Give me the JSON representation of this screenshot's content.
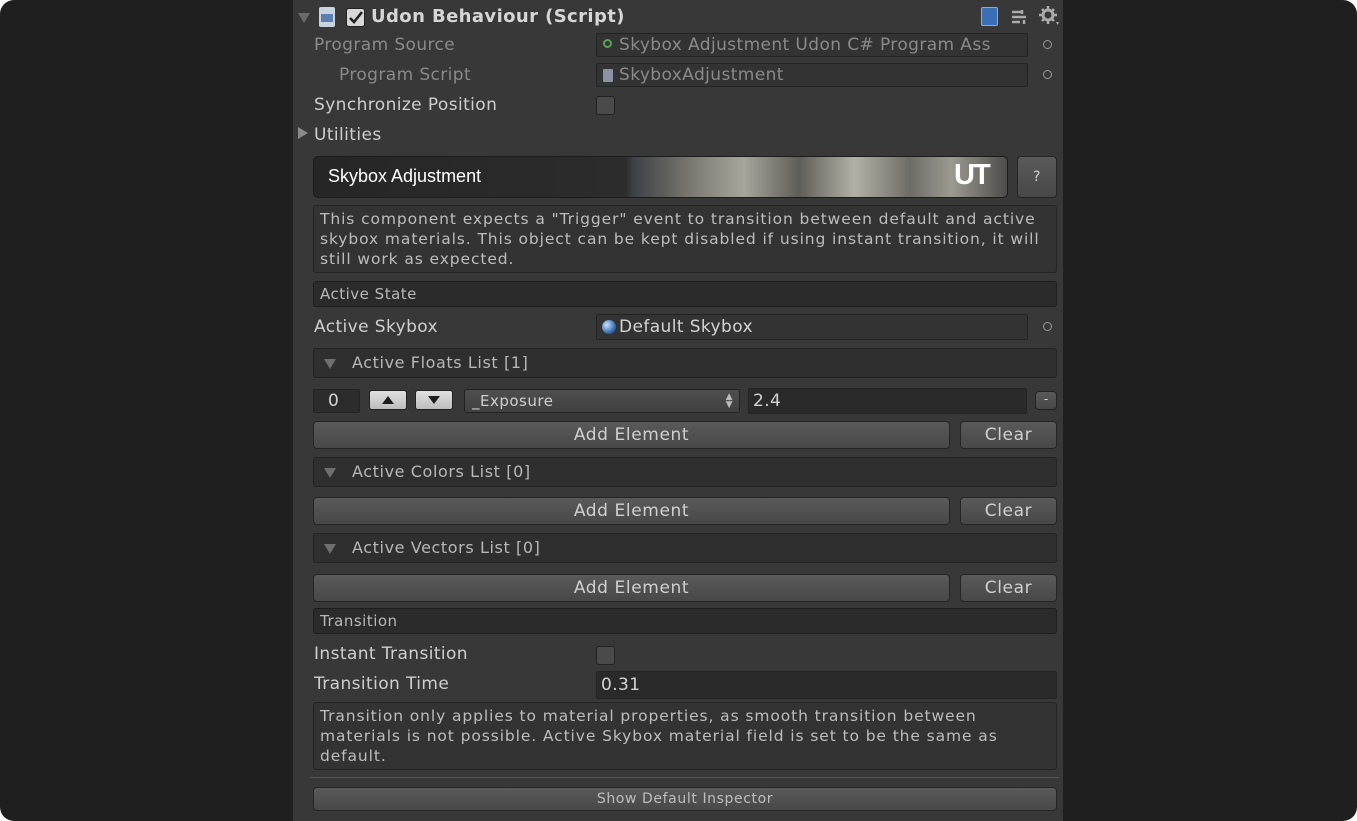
{
  "header": {
    "title": "Udon Behaviour (Script)",
    "enabled": true
  },
  "program_source": {
    "label": "Program Source",
    "value": "Skybox Adjustment Udon C# Program Ass"
  },
  "program_script": {
    "label": "Program Script",
    "value": "SkyboxAdjustment"
  },
  "synchronize_position": {
    "label": "Synchronize Position",
    "checked": false
  },
  "utilities": {
    "label": "Utilities"
  },
  "banner": {
    "title": "Skybox Adjustment",
    "logo_text": "UT",
    "help_label": "?"
  },
  "description": "This component expects a \"Trigger\" event to transition between default and active skybox materials. This object can be kept disabled if using instant transition, it will still work as expected.",
  "active_state": {
    "section_label": "Active State",
    "active_skybox": {
      "label": "Active Skybox",
      "value": "Default Skybox"
    },
    "floats_list": {
      "header": "Active Floats List [1]",
      "items": [
        {
          "index": "0",
          "property": "_Exposure",
          "value": "2.4",
          "remove_label": "-"
        }
      ],
      "add_label": "Add Element",
      "clear_label": "Clear"
    },
    "colors_list": {
      "header": "Active Colors List [0]",
      "add_label": "Add Element",
      "clear_label": "Clear"
    },
    "vectors_list": {
      "header": "Active Vectors List [0]",
      "add_label": "Add Element",
      "clear_label": "Clear"
    }
  },
  "transition": {
    "section_label": "Transition",
    "instant_transition": {
      "label": "Instant Transition",
      "checked": false
    },
    "transition_time": {
      "label": "Transition Time",
      "value": "0.31"
    },
    "note": "Transition only applies to material properties, as smooth transition between materials is not possible. Active Skybox material field is set to be the same as default."
  },
  "footer": {
    "show_default_inspector": "Show Default Inspector"
  },
  "colors": {
    "panel_bg": "#383838",
    "field_bg": "#2a2a2a",
    "text": "#cfcfcf",
    "accent_blue": "#3a6fb5"
  }
}
